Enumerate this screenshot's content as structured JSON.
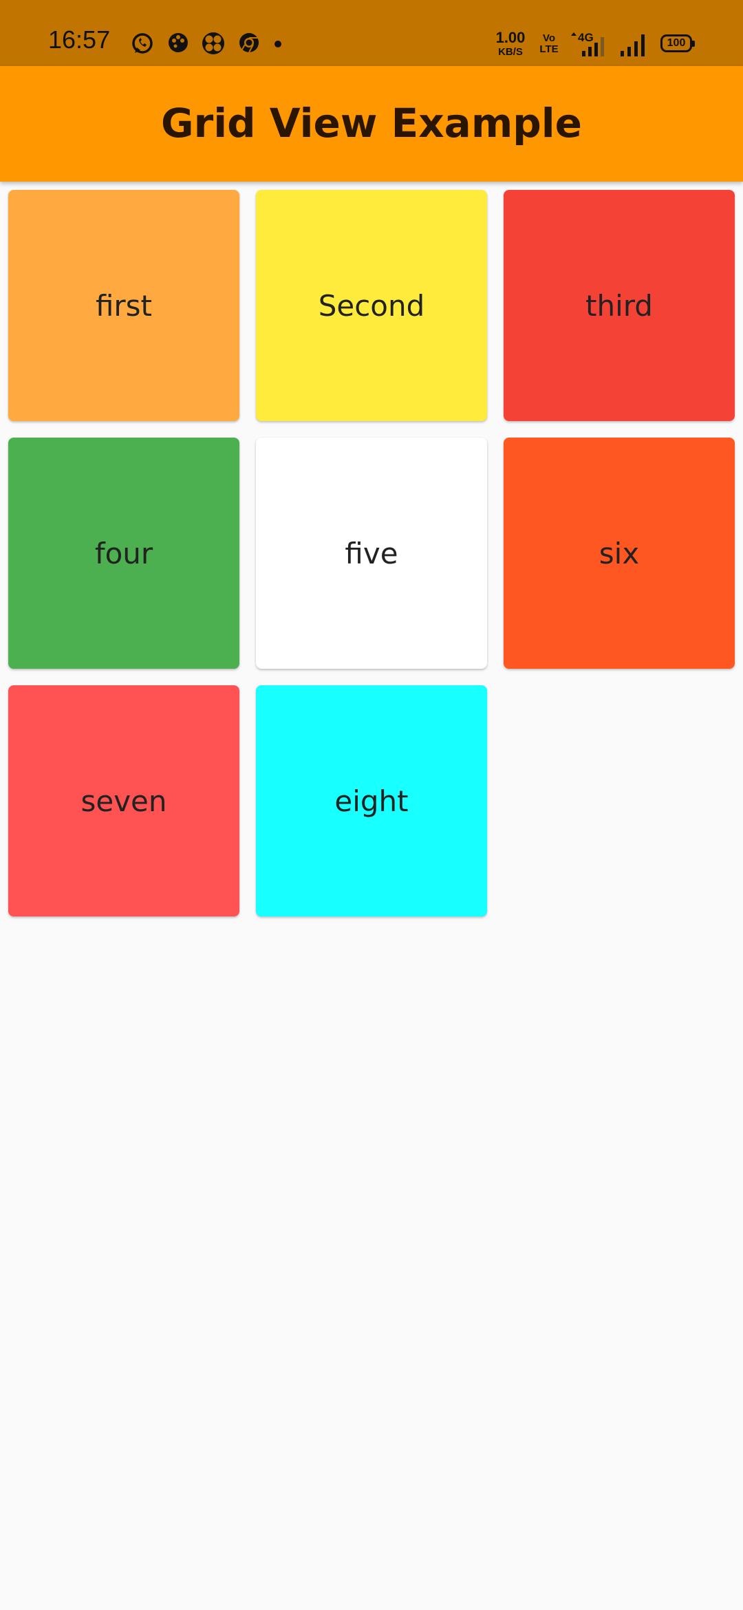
{
  "status_bar": {
    "time": "16:57",
    "net_speed_value": "1.00",
    "net_speed_unit": "KB/S",
    "volte_top": "Vo",
    "volte_bottom": "LTE",
    "network_type": "4G",
    "battery": "100",
    "notification_icons": [
      "whatsapp-icon",
      "palette-icon",
      "fan-icon",
      "chrome-icon",
      "dot-icon"
    ]
  },
  "app_bar": {
    "title": "Grid View Example",
    "color": "#ff9800"
  },
  "grid": {
    "tiles": [
      {
        "label": "first",
        "color": "#ffa940"
      },
      {
        "label": "Second",
        "color": "#ffeb3b"
      },
      {
        "label": "third",
        "color": "#f44336"
      },
      {
        "label": "four",
        "color": "#4caf50"
      },
      {
        "label": "five",
        "color": "#ffffff"
      },
      {
        "label": "six",
        "color": "#ff5722"
      },
      {
        "label": "seven",
        "color": "#ff5252"
      },
      {
        "label": "eight",
        "color": "#18ffff"
      }
    ]
  }
}
